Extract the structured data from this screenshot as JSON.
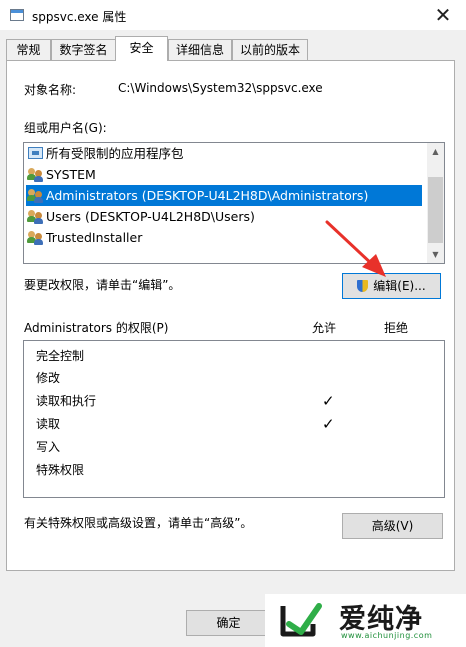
{
  "window": {
    "title": "sppsvc.exe 属性",
    "close_glyph": "✕"
  },
  "tabs": [
    {
      "label": "常规",
      "active": false
    },
    {
      "label": "数字签名",
      "active": false
    },
    {
      "label": "安全",
      "active": true
    },
    {
      "label": "详细信息",
      "active": false
    },
    {
      "label": "以前的版本",
      "active": false
    }
  ],
  "object": {
    "label": "对象名称:",
    "value": "C:\\Windows\\System32\\sppsvc.exe"
  },
  "groups": {
    "label": "组或用户名(G):",
    "items": [
      {
        "label": "所有受限制的应用程序包",
        "icon": "package-icon",
        "selected": false
      },
      {
        "label": "SYSTEM",
        "icon": "users-icon",
        "selected": false
      },
      {
        "label": "Administrators (DESKTOP-U4L2H8D\\Administrators)",
        "icon": "users-icon",
        "selected": true
      },
      {
        "label": "Users (DESKTOP-U4L2H8D\\Users)",
        "icon": "users-icon",
        "selected": false
      },
      {
        "label": "TrustedInstaller",
        "icon": "users-icon",
        "selected": false
      }
    ],
    "scroll_up": "▲",
    "scroll_down": "▼"
  },
  "edit": {
    "hint": "要更改权限，请单击“编辑”。",
    "button_label": "编辑(E)..."
  },
  "permissions": {
    "title": "Administrators 的权限(P)",
    "allow_header": "允许",
    "deny_header": "拒绝",
    "rows": [
      {
        "name": "完全控制",
        "allow": "",
        "deny": ""
      },
      {
        "name": "修改",
        "allow": "",
        "deny": ""
      },
      {
        "name": "读取和执行",
        "allow": "✓",
        "deny": ""
      },
      {
        "name": "读取",
        "allow": "✓",
        "deny": ""
      },
      {
        "name": "写入",
        "allow": "",
        "deny": ""
      },
      {
        "name": "特殊权限",
        "allow": "",
        "deny": ""
      }
    ]
  },
  "advanced": {
    "hint": "有关特殊权限或高级设置，请单击“高级”。",
    "button_label": "高级(V)"
  },
  "footer": {
    "ok_label": "确定"
  },
  "watermark": {
    "brand": "爱纯净",
    "url": "www.aichunjing.com"
  },
  "colors": {
    "selection": "#0078d7",
    "watermark_green": "#1f8f3a",
    "arrow_red": "#e8312a"
  }
}
